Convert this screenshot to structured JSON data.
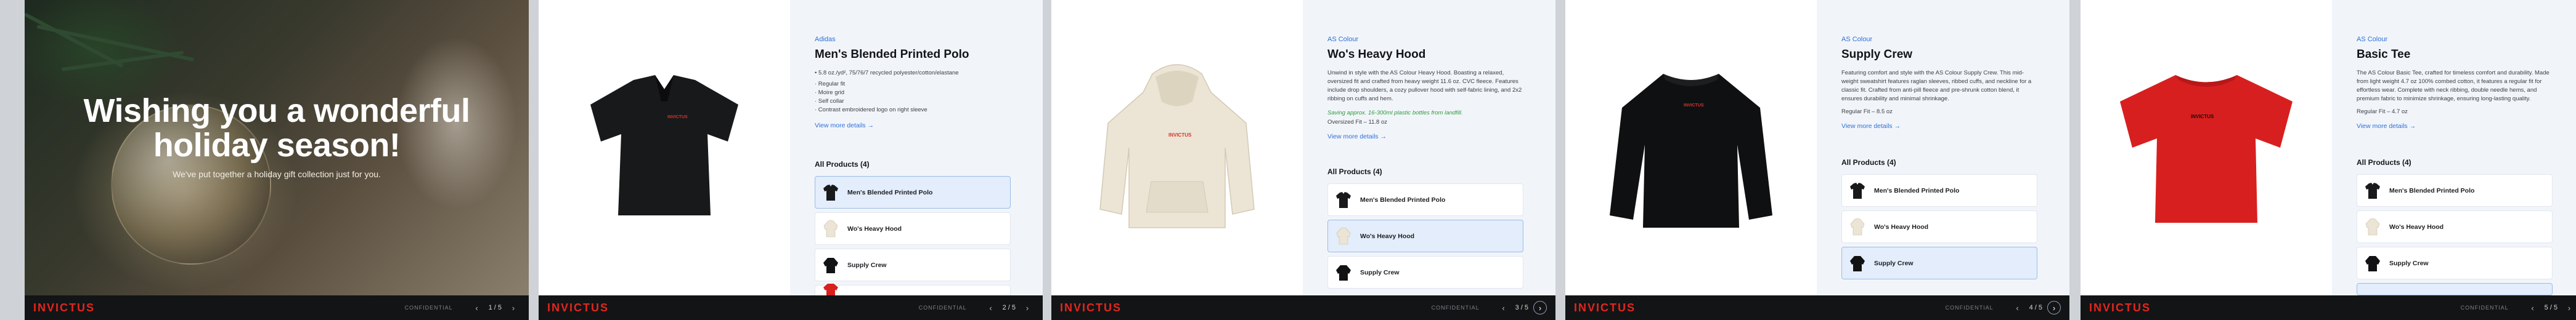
{
  "footer": {
    "logo": "INVICTUS",
    "confidential": "CONFIDENTIAL",
    "prev": "‹",
    "next": "›"
  },
  "hero": {
    "title_line1": "Wishing you a wonderful",
    "title_line2": "holiday season!",
    "subtitle": "We've put together a holiday gift collection just for you."
  },
  "colors": {
    "accent": "#2f6fd6",
    "logo_red": "#e2261d",
    "footer_bg": "#131416",
    "panel_bg": "#f1f5fa"
  },
  "slides": [
    {
      "counter": "1 / 5"
    },
    {
      "counter": "2 / 5",
      "brand": "Adidas",
      "title": "Men's Blended Printed Polo",
      "desc": "• 5.8 oz./yd², 75/76/7 recycled polyester/cotton/elastane",
      "bullets": [
        "· Regular fit",
        "· Moire grid",
        "· Self collar",
        "· Contrast embroidered logo on right sleeve"
      ],
      "more": "View more details →",
      "all_products": "All Products (4)",
      "products": [
        "Men's Blended Printed Polo",
        "Wo's Heavy Hood",
        "Supply Crew"
      ]
    },
    {
      "counter": "3 / 5",
      "brand": "AS Colour",
      "title": "Wo's Heavy Hood",
      "desc": "Unwind in style with the AS Colour Heavy Hood. Boasting a relaxed, oversized fit and crafted from heavy weight 11.6 oz. CVC fleece. Features include drop shoulders, a cozy pullover hood with self-fabric lining, and 2x2 ribbing on cuffs and hem.",
      "eco": "Saving approx. 16-300ml plastic bottles from landfill.",
      "fit": "Oversized Fit – 11.8 oz",
      "more": "View more details →",
      "all_products": "All Products (4)",
      "products": [
        "Men's Blended Printed Polo",
        "Wo's Heavy Hood",
        "Supply Crew"
      ]
    },
    {
      "counter": "4 / 5",
      "brand": "AS Colour",
      "title": "Supply Crew",
      "desc": "Featuring comfort and style with the AS Colour Supply Crew. This mid-weight sweatshirt features raglan sleeves, ribbed cuffs, and neckline for a classic fit. Crafted from anti-pill fleece and pre-shrunk cotton blend, it ensures durability and minimal shrinkage.",
      "fit": "Regular Fit – 8.5 oz",
      "more": "View more details →",
      "all_products": "All Products (4)",
      "products": [
        "Men's Blended Printed Polo",
        "Wo's Heavy Hood",
        "Supply Crew"
      ]
    },
    {
      "counter": "5 / 5",
      "brand": "AS Colour",
      "title": "Basic Tee",
      "desc": "The AS Colour Basic Tee, crafted for timeless comfort and durability. Made from light weight 4.7 oz 100% combed cotton, it features a regular fit for effortless wear. Complete with neck ribbing, double needle hems, and premium fabric to minimize shrinkage, ensuring long-lasting quality.",
      "fit": "Regular Fit – 4.7 oz",
      "more": "View more details →",
      "all_products": "All Products (4)",
      "products": [
        "Men's Blended Printed Polo",
        "Wo's Heavy Hood",
        "Supply Crew"
      ]
    }
  ]
}
